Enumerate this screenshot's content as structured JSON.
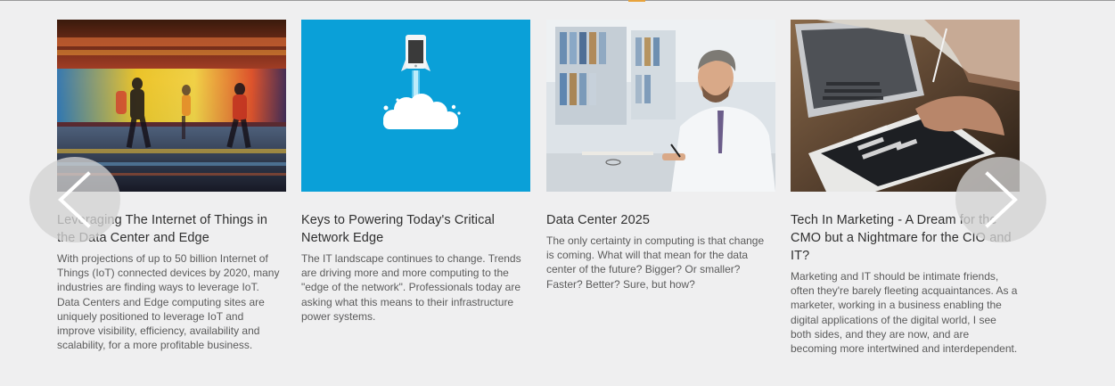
{
  "carousel": {
    "prev_icon": "chevron-left-icon",
    "next_icon": "chevron-right-icon",
    "cards": [
      {
        "image": "people-walking-motion-blur-photo",
        "title": "Leveraging The Internet of Things in the Data Center and Edge",
        "description": "With projections of up to 50 billion Internet of Things (IoT) connected devices by 2020, many industries are finding ways to leverage IoT. Data Centers and Edge computing sites are uniquely positioned to leverage IoT and improve visibility, efficiency, availability and scalability, for a more profitable business."
      },
      {
        "image": "phone-rocket-cloud-illustration",
        "title": "Keys to Powering Today's Critical Network Edge",
        "description": "The IT landscape continues to change. Trends are driving more and more computing to the \"edge of the network\". Professionals today are asking what this means to their infrastructure power systems."
      },
      {
        "image": "man-writing-at-desk-photo",
        "title": "Data Center 2025",
        "description": "The only certainty in computing is that change is coming. What will that mean for the data center of the future? Bigger? Or smaller? Faster? Better? Sure, but how?"
      },
      {
        "image": "tablet-laptop-charts-photo",
        "title": "Tech In Marketing - A Dream for the CMO but a Nightmare for the CIO and IT?",
        "description": "Marketing and IT should be intimate friends, often they're barely fleeting acquaintances. As a marketer, working in a business enabling the digital applications of the digital world, I see both sides, and they are now, and are becoming more intertwined and interdependent."
      }
    ]
  },
  "colors": {
    "background": "#efeff0",
    "accent": "#e8a33c",
    "rocket_tile": "#0aa0d8"
  }
}
